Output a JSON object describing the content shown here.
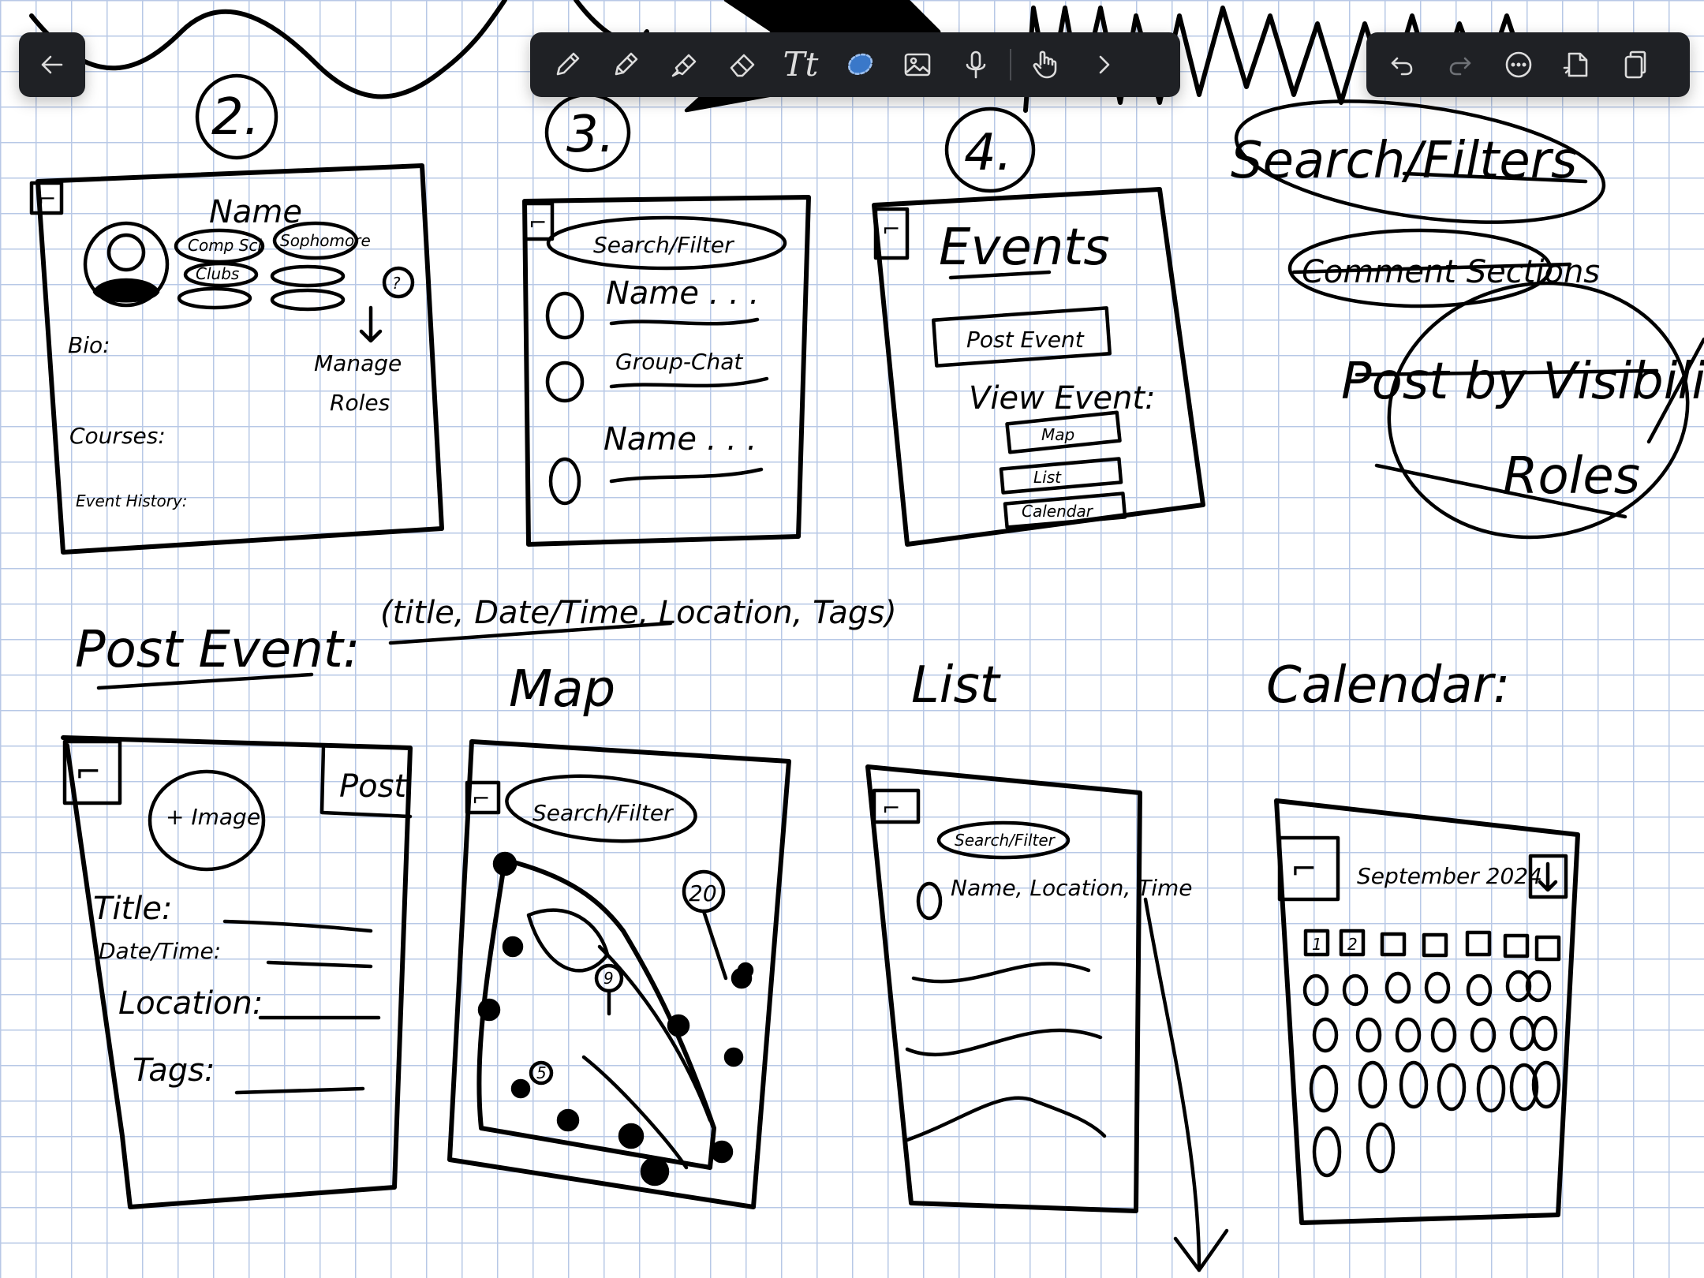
{
  "toolbar": {
    "back": {
      "icon": "back-arrow-icon"
    },
    "tools": [
      {
        "name": "pen-tool",
        "icon": "pen-icon"
      },
      {
        "name": "pencil-tool",
        "icon": "pencil-icon"
      },
      {
        "name": "highlighter-tool",
        "icon": "highlighter-icon"
      },
      {
        "name": "eraser-tool",
        "icon": "eraser-icon"
      },
      {
        "name": "text-tool",
        "icon": "text-icon",
        "label": "Tt"
      },
      {
        "name": "lasso-tool",
        "icon": "lasso-icon"
      },
      {
        "name": "image-tool",
        "icon": "image-icon"
      },
      {
        "name": "microphone-tool",
        "icon": "microphone-icon"
      },
      {
        "name": "touch-tool",
        "icon": "hand-pointer-icon"
      },
      {
        "name": "more-tools",
        "icon": "chevron-right-icon"
      }
    ],
    "actions": [
      {
        "name": "undo",
        "icon": "undo-icon"
      },
      {
        "name": "redo",
        "icon": "redo-icon"
      },
      {
        "name": "more-options",
        "icon": "more-icon"
      },
      {
        "name": "new-page",
        "icon": "new-page-icon"
      },
      {
        "name": "pages",
        "icon": "pages-icon"
      }
    ],
    "colors": {
      "bar": "#1f2125",
      "icon": "#dcdcdc",
      "lasso_blue": "#3a78c9",
      "grid": "#b8c8e6"
    }
  },
  "sketch": {
    "top_numbers": [
      "2.",
      "3.",
      "4."
    ],
    "profile": {
      "name": "Name",
      "tags": [
        "Comp Sci",
        "Sophomore",
        "Clubs"
      ],
      "badge": "?",
      "bio_label": "Bio:",
      "courses_label": "Courses:",
      "history_label": "Event History:",
      "manage": "Manage",
      "roles": "Roles"
    },
    "messages": {
      "search": "Search/Filter",
      "rows": [
        "Name . . .",
        "Group-Chat",
        "Name . . ."
      ]
    },
    "events": {
      "title": "Events",
      "post_button": "Post Event",
      "view_label": "View Event:",
      "options": [
        "Map",
        "List",
        "Calendar"
      ]
    },
    "side_notes": [
      "Search/Filters",
      "Comment Sections",
      "Post by Visibility",
      "Roles"
    ],
    "post_event": {
      "heading": "Post Event:",
      "fields_note": "(title, Date/Time, Location, Tags)",
      "image_label": "+ Image",
      "post_button": "Post",
      "fields": [
        "Title:",
        "Date/Time:",
        "Location:",
        "Tags:"
      ]
    },
    "map": {
      "heading": "Map",
      "search": "Search/Filter",
      "cluster": "20",
      "pins": [
        "9",
        "5"
      ]
    },
    "list": {
      "heading": "List",
      "search": "Search/Filter",
      "row": "Name, Location, Time"
    },
    "calendar": {
      "heading": "Calendar:",
      "month": "September 2024",
      "day_numbers": [
        "1",
        "2"
      ]
    }
  }
}
